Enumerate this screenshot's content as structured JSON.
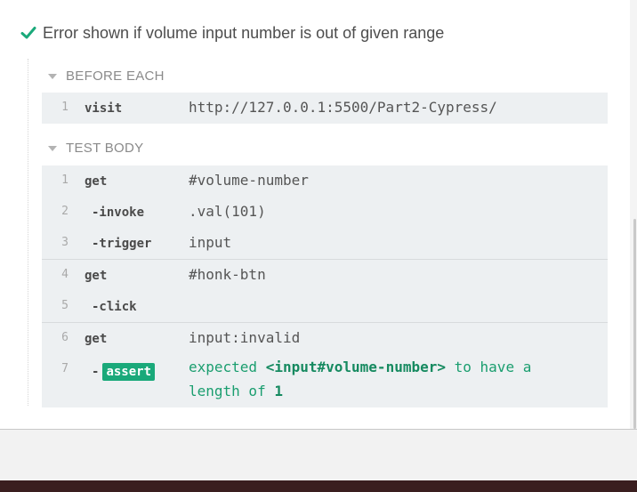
{
  "test": {
    "title": "Error shown if volume input number is out of given range",
    "status_icon": "check-icon",
    "status_color": "#1aa97a"
  },
  "before_each": {
    "label": "BEFORE EACH",
    "commands": [
      {
        "num": "1",
        "name": "visit",
        "message": "http://127.0.0.1:5500/Part2-Cypress/"
      }
    ]
  },
  "test_body": {
    "label": "TEST BODY",
    "groups": [
      {
        "commands": [
          {
            "num": "1",
            "name": "get",
            "message": "#volume-number"
          },
          {
            "num": "2",
            "name": "-invoke",
            "message": ".val(101)"
          },
          {
            "num": "3",
            "name": "-trigger",
            "message": "input"
          }
        ]
      },
      {
        "commands": [
          {
            "num": "4",
            "name": "get",
            "message": "#honk-btn"
          },
          {
            "num": "5",
            "name": "-click",
            "message": ""
          }
        ]
      },
      {
        "commands": [
          {
            "num": "6",
            "name": "get",
            "message": "input:invalid"
          }
        ]
      }
    ],
    "assert": {
      "num": "7",
      "dash": "-",
      "name": "assert",
      "msg_part1": "expected",
      "msg_subject": "<input#volume-number>",
      "msg_part2": "to have a",
      "msg_part3": "length of",
      "msg_value": "1"
    }
  },
  "colors": {
    "accent_green": "#1aa97a",
    "command_bg": "#edf0f2"
  }
}
